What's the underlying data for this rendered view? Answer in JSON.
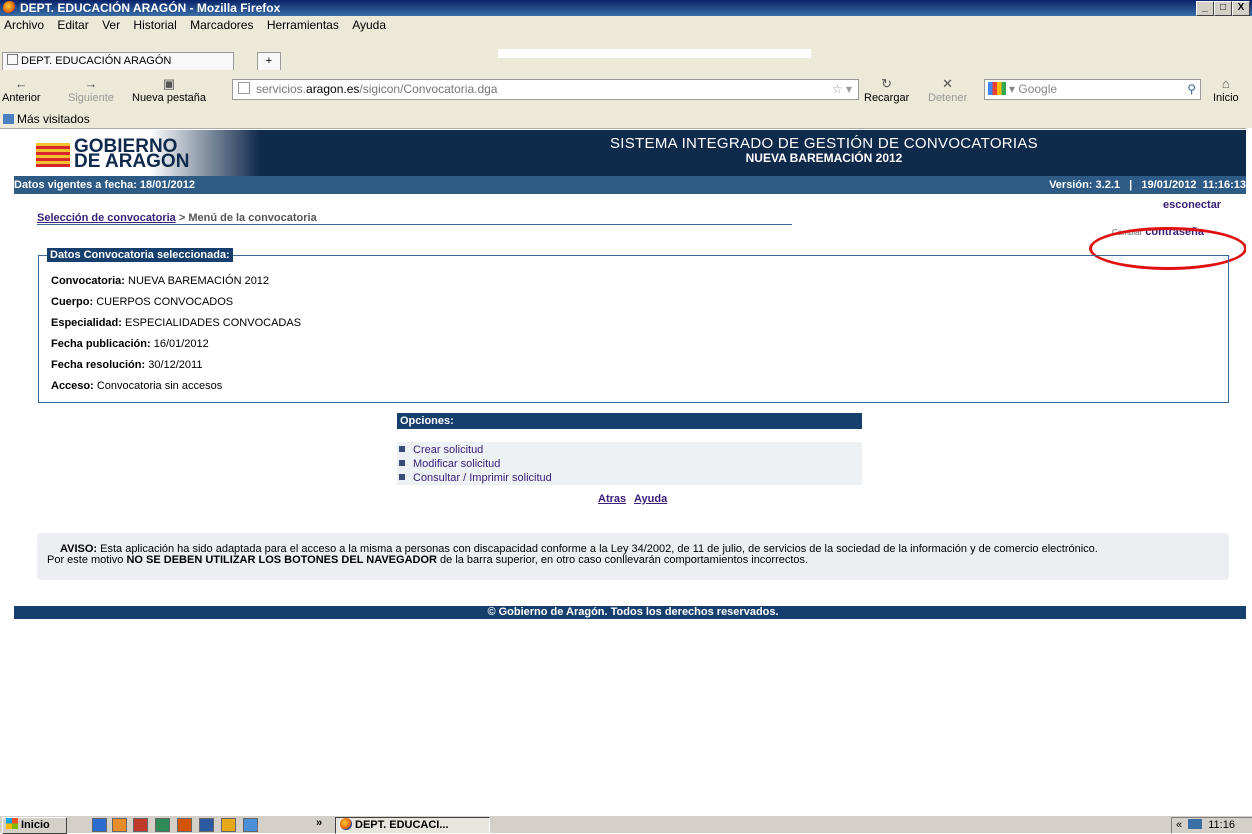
{
  "window": {
    "title": "DEPT. EDUCACIÓN ARAGÓN - Mozilla Firefox",
    "min": "_",
    "max": "□",
    "close": "X"
  },
  "menu": [
    "Archivo",
    "Editar",
    "Ver",
    "Historial",
    "Marcadores",
    "Herramientas",
    "Ayuda"
  ],
  "tab": {
    "label": "DEPT. EDUCACIÓN ARAGÓN",
    "new": "+"
  },
  "nav": {
    "back": "Anterior",
    "forward": "Siguiente",
    "newtab": "Nueva pestaña",
    "reload": "Recargar",
    "stop": "Detener",
    "home": "Inicio",
    "url_domain": "servicios.aragon.es",
    "url_prefix": "servicios.",
    "url_strong": "aragon.es",
    "url_path": "/sigicon/Convocatoria.dga",
    "search_placeholder": "Google"
  },
  "bookmarks": {
    "label": "Más visitados"
  },
  "banner": {
    "logo_line1": "GOBIERNO",
    "logo_line2": "DE ARAGON",
    "system_title": "SISTEMA INTEGRADO DE GESTIÓN DE CONVOCATORIAS",
    "subtitle": "NUEVA BAREMACIÓN 2012"
  },
  "infobar": {
    "left": "Datos vigentes a fecha: 18/01/2012",
    "right": "Versión: 3.2.1   |   19/01/2012  11:16:13"
  },
  "breadcrumb": {
    "link": "Selección de convocatoria",
    "sep": " > ",
    "current": "Menú de la convocatoria"
  },
  "links": {
    "disconnect": "esconectar",
    "change_password_prefix": "Cambiar",
    "change_password": "contraseña"
  },
  "datos": {
    "header": "Datos Convocatoria seleccionada:",
    "rows": [
      {
        "label": "Convocatoria:",
        "value": "NUEVA BAREMACIÓN 2012"
      },
      {
        "label": "Cuerpo:",
        "value": "CUERPOS CONVOCADOS"
      },
      {
        "label": "Especialidad:",
        "value": "ESPECIALIDADES CONVOCADAS"
      },
      {
        "label": "Fecha publicación:",
        "value": "16/01/2012"
      },
      {
        "label": "Fecha resolución:",
        "value": "30/12/2011"
      },
      {
        "label": "Acceso:",
        "value": "Convocatoria sin accesos"
      }
    ]
  },
  "opciones": {
    "header": "Opciones:",
    "items": [
      "Crear solicitud",
      "Modificar solicitud",
      "Consultar / Imprimir solicitud"
    ]
  },
  "bottom_links": {
    "back": "Atras",
    "help": "Ayuda"
  },
  "aviso": {
    "bold1": "AVISO:",
    "text1": " Esta aplicación ha sido adaptada para el acceso a la misma a personas con discapacidad conforme a la Ley 34/2002, de 11 de julio, de servicios de la sociedad de la información y de comercio electrónico.",
    "text2a": "Por este motivo ",
    "bold2": "NO SE DEBEN UTILIZAR LOS BOTONES DEL NAVEGADOR",
    "text2b": " de la barra superior, en otro caso conllevarán comportamientos incorrectos."
  },
  "footer": "© Gobierno de Aragón. Todos los derechos reservados.",
  "taskbar": {
    "start": "Inicio",
    "app": "DEPT. EDUCACI...",
    "more": "»",
    "clock": "11:16",
    "tray_arrow": "«"
  }
}
